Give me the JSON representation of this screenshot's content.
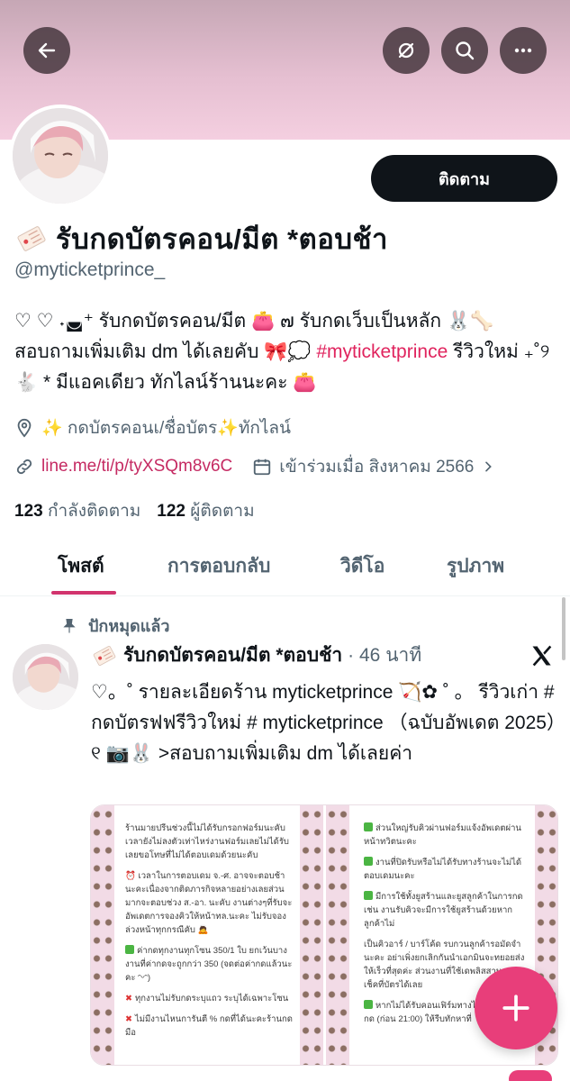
{
  "profile": {
    "display_name": "รับกดบัตรคอน/มีต *ตอบช้า",
    "handle": "@myticketprince_",
    "follow_label": "ติดตาม",
    "bio_part1": "♡ ♡ ˖◛⁺ รับกดบัตรคอน/มีต 👛 ๗ รับกดเว็บเป็นหลัก 🐰🦴 สอบถามเพิ่มเติม dm ได้เลยคับ 🎀💭 ",
    "bio_hashtag": "#myticketprince",
    "bio_part2": " รีวิวใหม่ ₊˚୨🐇 * มีแอคเดียว ทักไลน์ร้านนะคะ 👛",
    "location": "✨ กดบัตรคอนเ/ชื่อบัตร✨ทักไลน์",
    "link": "line.me/ti/p/tyXSQm8v6C",
    "joined": "เข้าร่วมเมื่อ สิงหาคม 2566",
    "following_count": "123",
    "following_label": "กำลังติดตาม",
    "followers_count": "122",
    "followers_label": "ผู้ติดตาม"
  },
  "tabs": [
    {
      "label": "โพสต์",
      "active": true
    },
    {
      "label": "การตอบกลับ",
      "active": false
    },
    {
      "label": "วิดีโอ",
      "active": false
    },
    {
      "label": "รูปภาพ",
      "active": false
    }
  ],
  "post": {
    "pinned_label": "ปักหมุดแล้ว",
    "author": "รับกดบัตรคอน/มีต *ตอบช้า",
    "time": "· 46 นาที",
    "text": "♡。˚ รายละเอียดร้าน myticketprince 🏹✿ ˚ 。 รีวิวเก่า # กดบัตรฟฟรีวิวใหม่ # myticketprince （ฉบับอัพเดต 2025）୧ 📷🐰 >สอบถามเพิ่มเติม dm ได้เลยค่า",
    "media_left": {
      "p1": "ร้านมายปรีนช่วงนี้ไม่ได้รับกรอกฟอร์มนะคับเวลายังไม่ลงตัวเท่าไหร่งานฟอร์มเลยไม่ได้รับเลยขอโทษที่ไม่ได้ตอบเดมด้วยนะคับ",
      "p2": "⏰ เวลาในการตอบเดม จ.-ศ. อาจจะตอบช้านะคะเนื่องจากติดภารกิจหลายอย่างเลยส่วนมากจะตอบช่วง ส.-อา. นะคับ งานต่างๆที่รับจะอัพเดตการจองคิวให้หน้าทล.นะคะ ไม่รับจองล่วงหน้าทุกกรณีคับ 🙇",
      "p3": "ค่ากดทุกงานทุกโซน 350/1 ใบ ยกเว้นบางงานที่ค่ากดจะถูกกว่า 350 (จดต่อค่ากดแล้วนะคะ ᵔᵕᵔ)",
      "p4": "ทุกงานไม่รับกดระบุแถว ระบุได้เฉพาะโซน",
      "p5": "ไม่มีงานไหนการันตี % กดที่ได้นะคะร้านกดมือ"
    },
    "media_right": {
      "p1": "ส่วนใหญ่รับคิวผ่านฟอร์มแจ้งอัพเดตผ่านหน้าทวิตนะคะ",
      "p2": "งานที่ปิดรับหรือไม่ได้รับทางร้านจะไม่ได้ตอบเดมนะคะ",
      "p3": "มีการใช้ทั้งยูสร้านและยูสลูกค้าในการกด เช่น งานรับคิวจะมีการใช้ยูสร้านด้วยหากลูกค้าไม่",
      "p4": "เป็นคิวอาร์ / บาร์โค้ด รบกวนลูกค้ารอมัดจำนะคะ อย่าเพิ่งยกเลิกกันนำเอกมินจะทยอยส่งให้เร็วที่สุดค่ะ ส่วนงานที่ใช้เดพลิสสามารถเช็คที่บัตรได้เลย",
      "p5": "หากไม่ได้รับคอนเฟิร์มทางไลน์ก่อนวันที่กด (ก่อน 21:00) ให้รีบทักหาที่"
    }
  },
  "colors": {
    "accent": "#e83e7a",
    "tab_indicator": "#d1336d",
    "link": "#c52a62",
    "banner": "#f4cfe0",
    "follow_button": "#0f1419"
  },
  "icons": [
    "arrow-left-icon",
    "eye-slash-icon",
    "search-icon",
    "more-horizontal-icon",
    "ticket-emoji-icon",
    "location-icon",
    "link-icon",
    "calendar-icon",
    "chevron-right-icon",
    "pin-icon",
    "x-logo-icon",
    "plus-icon"
  ]
}
